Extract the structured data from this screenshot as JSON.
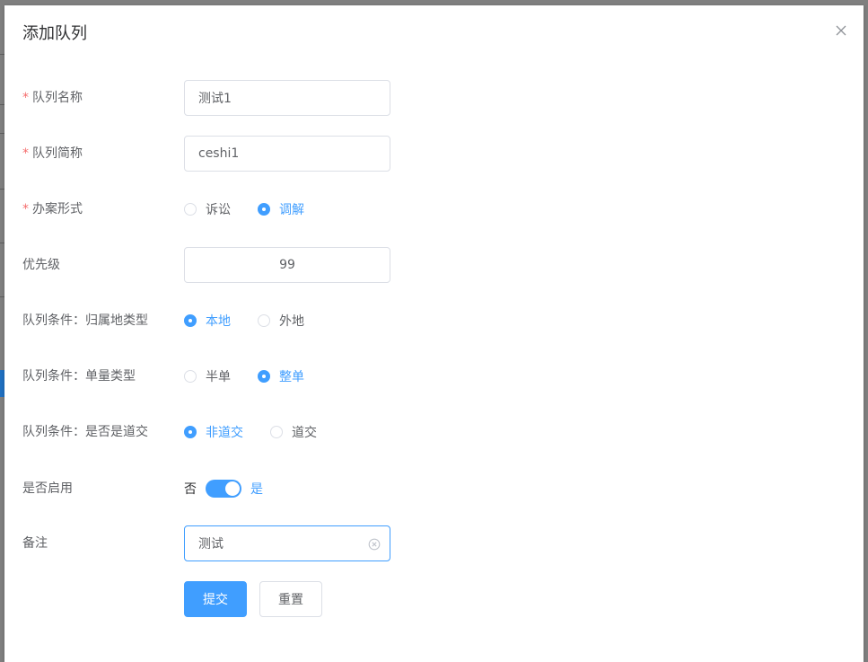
{
  "dialog": {
    "title": "添加队列"
  },
  "form": {
    "queue_name": {
      "label": "队列名称",
      "required": true,
      "value": "测试1"
    },
    "queue_short_name": {
      "label": "队列简称",
      "required": true,
      "value": "ceshi1"
    },
    "case_mode": {
      "label": "办案形式",
      "required": true,
      "options": [
        "诉讼",
        "调解"
      ],
      "selected": 1
    },
    "priority": {
      "label": "优先级",
      "value": "99"
    },
    "cond_region": {
      "label": "队列条件：归属地类型",
      "options": [
        "本地",
        "外地"
      ],
      "selected": 0
    },
    "cond_volume": {
      "label": "队列条件：单量类型",
      "options": [
        "半单",
        "整单"
      ],
      "selected": 1
    },
    "cond_road": {
      "label": "队列条件：是否是道交",
      "options": [
        "非道交",
        "道交"
      ],
      "selected": 0
    },
    "enabled": {
      "label": "是否启用",
      "off_label": "否",
      "on_label": "是",
      "value": true
    },
    "remark": {
      "label": "备注",
      "value": "测试"
    }
  },
  "actions": {
    "submit_label": "提交",
    "reset_label": "重置"
  },
  "colors": {
    "primary": "#409eff",
    "required": "#f56c6c",
    "border": "#dcdfe6"
  }
}
